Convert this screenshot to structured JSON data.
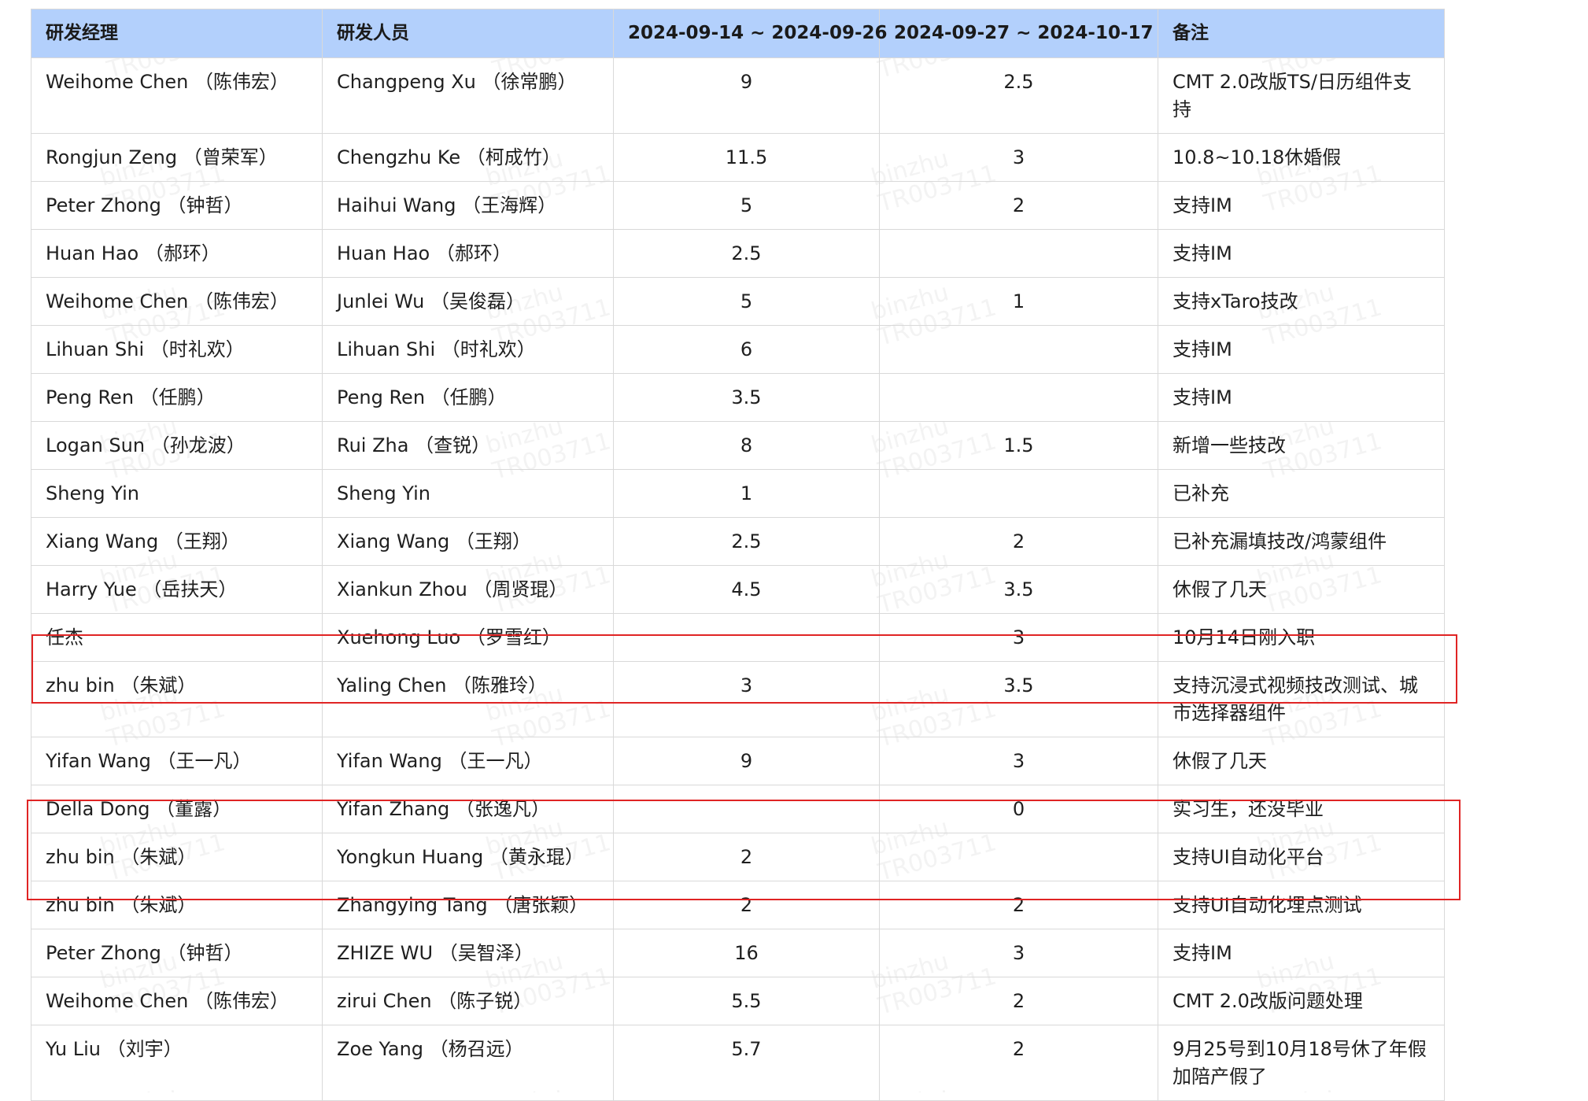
{
  "table": {
    "headers": [
      "研发经理",
      "研发人员",
      "2024-09-14 ~ 2024-09-26",
      "2024-09-27 ~ 2024-10-17",
      "备注"
    ],
    "rows": [
      {
        "manager": "Weihome Chen （陈伟宏）",
        "developer": "Changpeng Xu （徐常鹏）",
        "period1": "9",
        "period2": "2.5",
        "note": "CMT 2.0改版TS/日历组件支持"
      },
      {
        "manager": "Rongjun Zeng （曾荣军）",
        "developer": "Chengzhu Ke （柯成竹）",
        "period1": "11.5",
        "period2": "3",
        "note": "10.8~10.18休婚假"
      },
      {
        "manager": "Peter Zhong （钟哲）",
        "developer": "Haihui Wang （王海辉）",
        "period1": "5",
        "period2": "2",
        "note": "支持IM"
      },
      {
        "manager": "Huan Hao （郝环）",
        "developer": "Huan Hao （郝环）",
        "period1": "2.5",
        "period2": "",
        "note": "支持IM"
      },
      {
        "manager": "Weihome Chen （陈伟宏）",
        "developer": "Junlei Wu （吴俊磊）",
        "period1": "5",
        "period2": "1",
        "note": "支持xTaro技改"
      },
      {
        "manager": "Lihuan Shi （时礼欢）",
        "developer": "Lihuan Shi （时礼欢）",
        "period1": "6",
        "period2": "",
        "note": "支持IM"
      },
      {
        "manager": "Peng Ren （任鹏）",
        "developer": "Peng Ren （任鹏）",
        "period1": "3.5",
        "period2": "",
        "note": "支持IM"
      },
      {
        "manager": "Logan Sun （孙龙波）",
        "developer": "Rui Zha （查锐）",
        "period1": "8",
        "period2": "1.5",
        "note": "新增一些技改"
      },
      {
        "manager": "Sheng Yin",
        "developer": "Sheng Yin",
        "period1": "1",
        "period2": "",
        "note": "已补充"
      },
      {
        "manager": "Xiang Wang （王翔）",
        "developer": "Xiang Wang （王翔）",
        "period1": "2.5",
        "period2": "2",
        "note": "已补充漏填技改/鸿蒙组件"
      },
      {
        "manager": "Harry Yue （岳扶天）",
        "developer": "Xiankun Zhou （周贤琨）",
        "period1": "4.5",
        "period2": "3.5",
        "note": "休假了几天"
      },
      {
        "manager": "任杰",
        "developer": "Xuehong Luo （罗雪红）",
        "period1": "",
        "period2": "3",
        "note": "10月14日刚入职"
      },
      {
        "manager": "zhu bin （朱斌）",
        "developer": "Yaling Chen （陈雅玲）",
        "period1": "3",
        "period2": "3.5",
        "note": "支持沉浸式视频技改测试、城市选择器组件",
        "tall": true
      },
      {
        "manager": "Yifan Wang （王一凡）",
        "developer": "Yifan Wang （王一凡）",
        "period1": "9",
        "period2": "3",
        "note": "休假了几天"
      },
      {
        "manager": "Della Dong （董露）",
        "developer": "Yifan Zhang （张逸凡）",
        "period1": "",
        "period2": "0",
        "note": "实习生，还没毕业"
      },
      {
        "manager": "zhu bin （朱斌）",
        "developer": "Yongkun Huang （黄永琨）",
        "period1": "2",
        "period2": "",
        "note": "支持UI自动化平台"
      },
      {
        "manager": "zhu bin （朱斌）",
        "developer": "Zhangying Tang （唐张颖）",
        "period1": "2",
        "period2": "2",
        "note": "支持UI自动化埋点测试"
      },
      {
        "manager": "Peter Zhong （钟哲）",
        "developer": "ZHIZE WU （吴智泽）",
        "period1": "16",
        "period2": "3",
        "note": "支持IM"
      },
      {
        "manager": "Weihome Chen （陈伟宏）",
        "developer": "zirui Chen （陈子锐）",
        "period1": "5.5",
        "period2": "2",
        "note": "CMT 2.0改版问题处理"
      },
      {
        "manager": "Yu Liu （刘宇）",
        "developer": "Zoe Yang （杨召远）",
        "period1": "5.7",
        "period2": "2",
        "note": "9月25号到10月18号休了年假加陪产假了",
        "tall": true
      }
    ]
  },
  "watermark": {
    "line1": "binzhu",
    "line2": "TR003711"
  },
  "colors": {
    "header_bg": "#b3d0fc",
    "border": "#d9d9d9",
    "highlight": "#e02424"
  }
}
